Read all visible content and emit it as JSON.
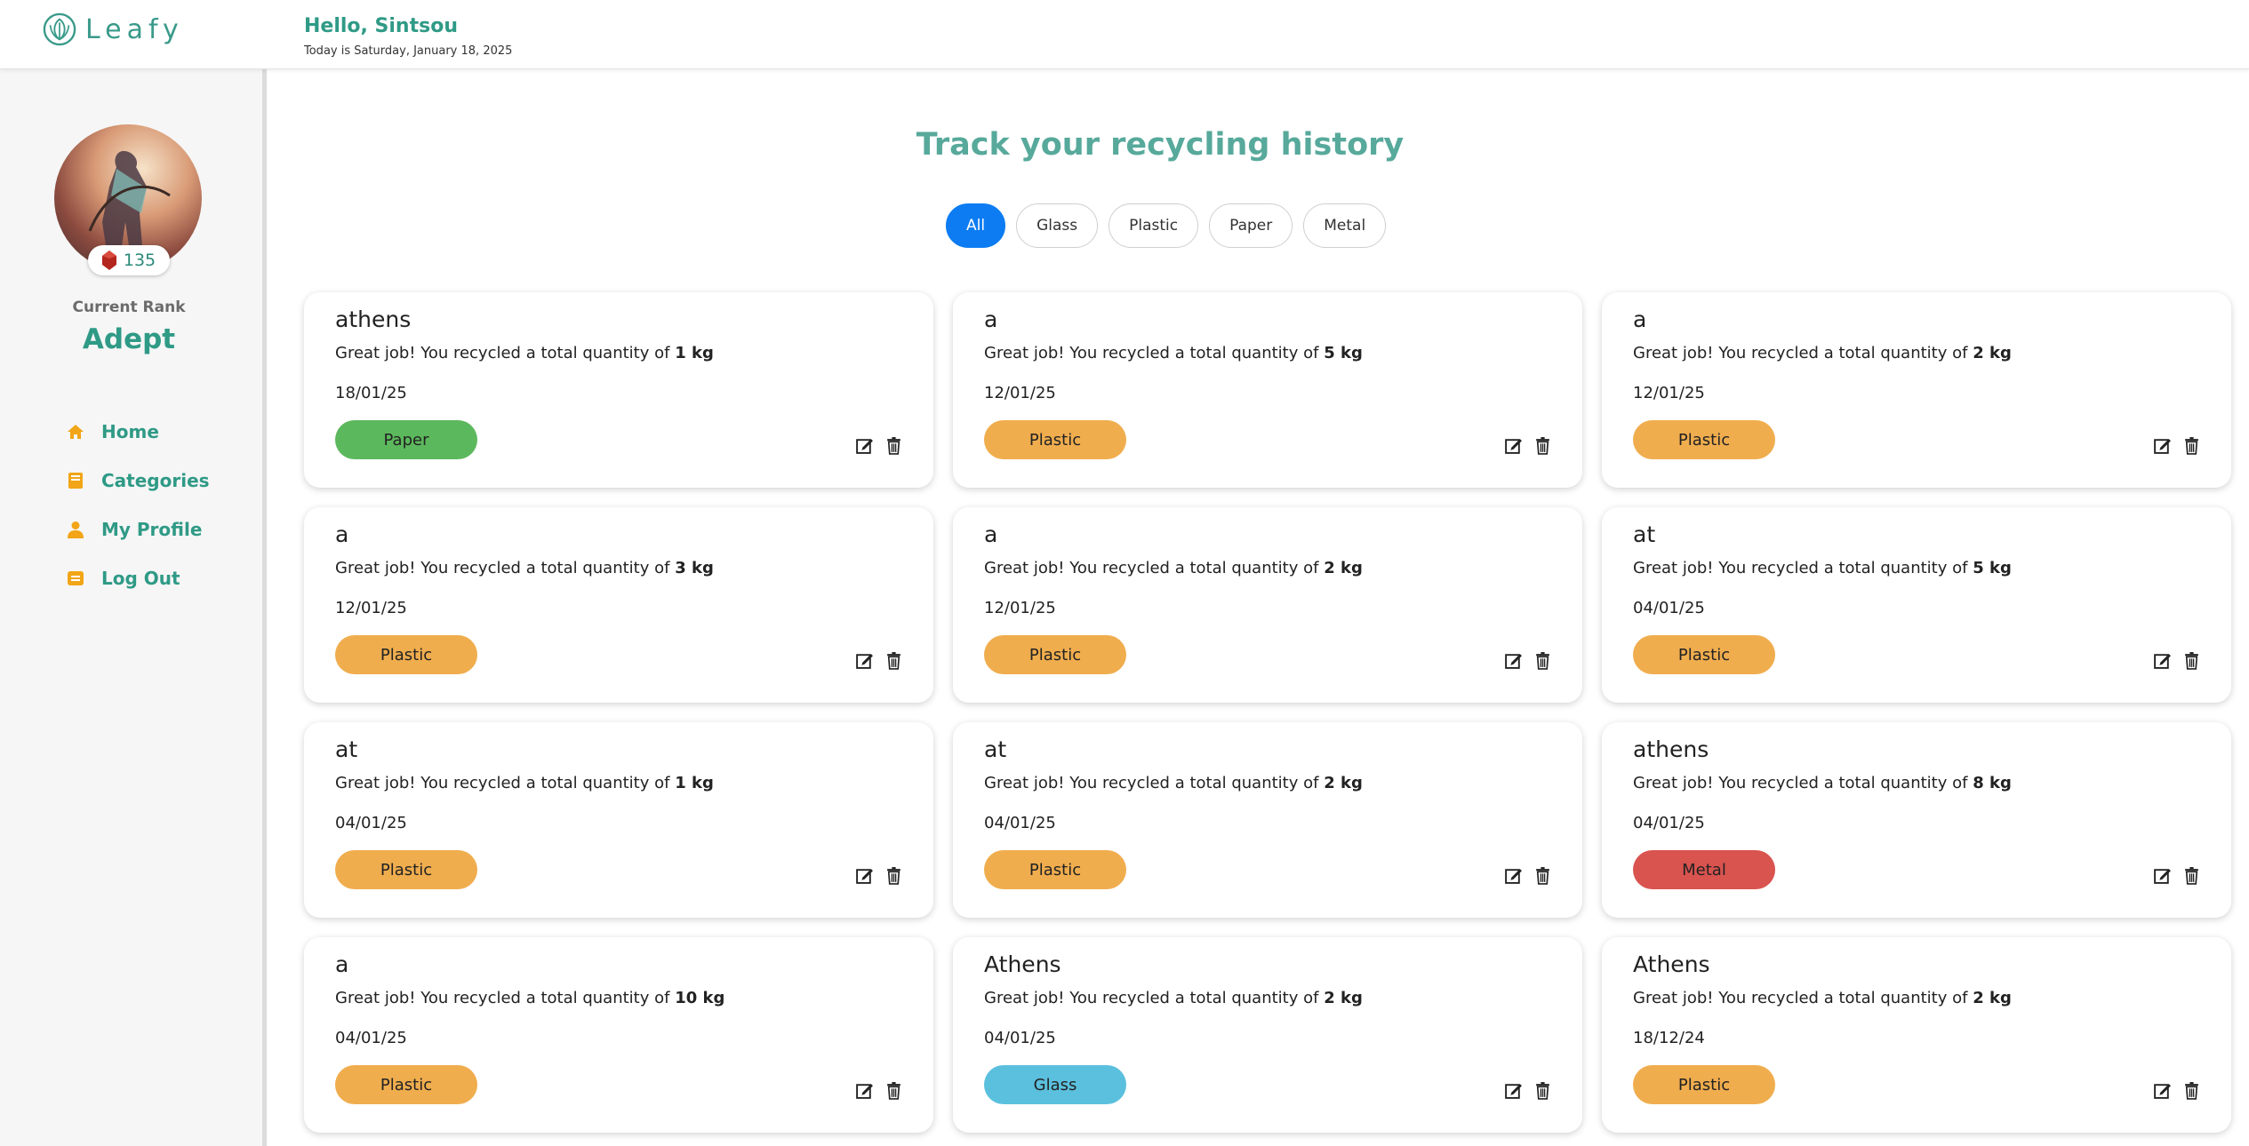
{
  "header": {
    "brand": "Leafy",
    "greeting": "Hello, Sintsou",
    "date_line": "Today is Saturday, January 18, 2025"
  },
  "sidebar": {
    "points": "135",
    "rank_label": "Current Rank",
    "rank": "Adept",
    "nav": [
      {
        "label": "Home",
        "icon": "home-icon"
      },
      {
        "label": "Categories",
        "icon": "book-icon"
      },
      {
        "label": "My Profile",
        "icon": "user-icon"
      },
      {
        "label": "Log Out",
        "icon": "logout-icon"
      }
    ]
  },
  "main": {
    "title": "Track your recycling history",
    "filters": [
      "All",
      "Glass",
      "Plastic",
      "Paper",
      "Metal"
    ],
    "active_filter": "All",
    "message_prefix": "Great job! You recycled a total quantity of",
    "cards": [
      {
        "title": "athens",
        "qty": "1 kg",
        "date": "18/01/25",
        "tag": "Paper"
      },
      {
        "title": "a",
        "qty": "5 kg",
        "date": "12/01/25",
        "tag": "Plastic"
      },
      {
        "title": "a",
        "qty": "2 kg",
        "date": "12/01/25",
        "tag": "Plastic"
      },
      {
        "title": "a",
        "qty": "3 kg",
        "date": "12/01/25",
        "tag": "Plastic"
      },
      {
        "title": "a",
        "qty": "2 kg",
        "date": "12/01/25",
        "tag": "Plastic"
      },
      {
        "title": "at",
        "qty": "5 kg",
        "date": "04/01/25",
        "tag": "Plastic"
      },
      {
        "title": "at",
        "qty": "1 kg",
        "date": "04/01/25",
        "tag": "Plastic"
      },
      {
        "title": "at",
        "qty": "2 kg",
        "date": "04/01/25",
        "tag": "Plastic"
      },
      {
        "title": "athens",
        "qty": "8 kg",
        "date": "04/01/25",
        "tag": "Metal"
      },
      {
        "title": "a",
        "qty": "10 kg",
        "date": "04/01/25",
        "tag": "Plastic"
      },
      {
        "title": "Athens",
        "qty": "2 kg",
        "date": "04/01/25",
        "tag": "Glass"
      },
      {
        "title": "Athens",
        "qty": "2 kg",
        "date": "18/12/24",
        "tag": "Plastic"
      }
    ]
  },
  "colors": {
    "accent": "#2f9a86",
    "active_filter": "#0d7cf2",
    "nav_icon": "#f2a516",
    "tag_paper": "#5cb85c",
    "tag_plastic": "#f0ad4e",
    "tag_metal": "#d9534f",
    "tag_glass": "#5bc0de"
  }
}
